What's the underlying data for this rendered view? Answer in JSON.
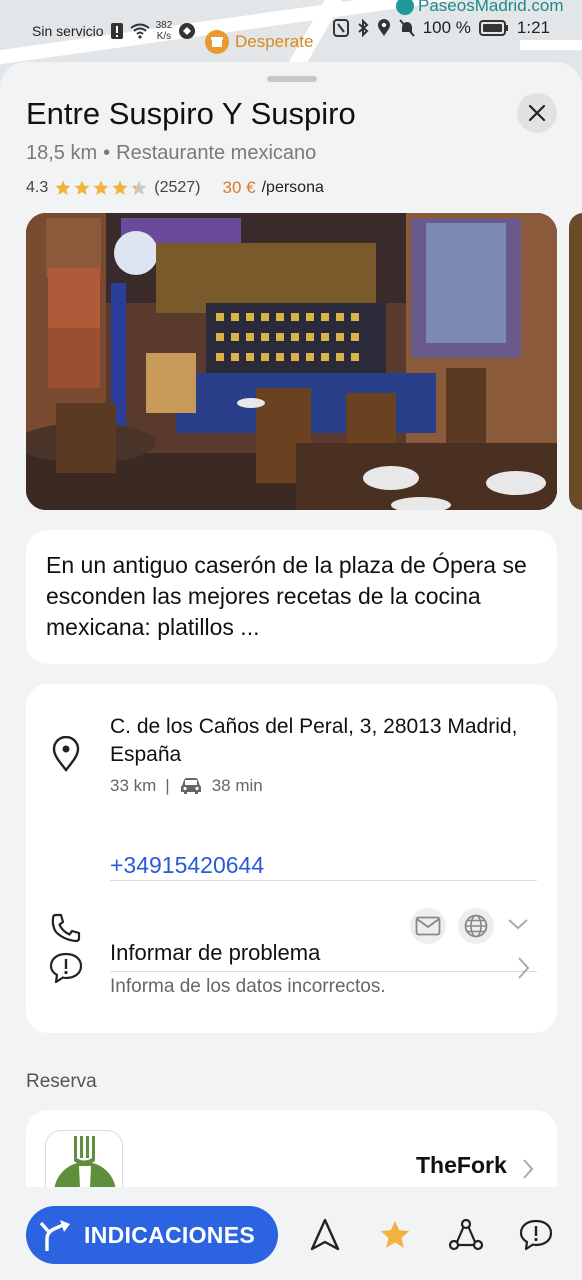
{
  "status_bar": {
    "carrier": "Sin servicio",
    "speed_value": "382",
    "speed_unit": "K/s",
    "battery": "100 %",
    "time": "1:21"
  },
  "map": {
    "poi_top": "PaseosMadrid.com",
    "poi_label": "Desperate"
  },
  "place": {
    "name": "Entre Suspiro Y Suspiro",
    "distance": "18,5 km",
    "separator": "•",
    "category": "Restaurante mexicano",
    "rating": "4.3",
    "rating_value": 4.3,
    "review_count": "(2527)",
    "price": "30 €",
    "price_unit": "/persona"
  },
  "description": "En un antiguo caserón de la plaza de Ópera se esconden las mejores recetas de la cocina mexicana: platillos ...",
  "address": {
    "text": "C. de los Caños del Peral, 3, 28013 Madrid, España",
    "distance": "33 km",
    "separator": "|",
    "drive_time": "38 min"
  },
  "contact": {
    "phone": "+34915420644"
  },
  "report": {
    "title": "Informar de problema",
    "subtitle": "Informa de los datos incorrectos."
  },
  "reservation": {
    "section_label": "Reserva",
    "provider": "TheFork"
  },
  "bottom_bar": {
    "directions_label": "INDICACIONES"
  },
  "colors": {
    "accent_blue": "#2b63e0",
    "phone_blue": "#2a5bd7",
    "price_orange": "#e07a2a",
    "star_gold": "#f2b33d",
    "thefork_green": "#5f8f3c"
  },
  "icons": {
    "close": "close-icon",
    "location": "location-pin-icon",
    "car": "car-icon",
    "phone": "phone-icon",
    "mail": "mail-icon",
    "globe": "globe-icon",
    "expand": "chevron-down-icon",
    "report": "report-bubble-icon",
    "chevron": "chevron-right-icon",
    "directions": "directions-arrow-icon",
    "navigate": "navigate-arrow-icon",
    "favorite": "star-icon",
    "route": "route-icon",
    "feedback": "feedback-icon"
  }
}
